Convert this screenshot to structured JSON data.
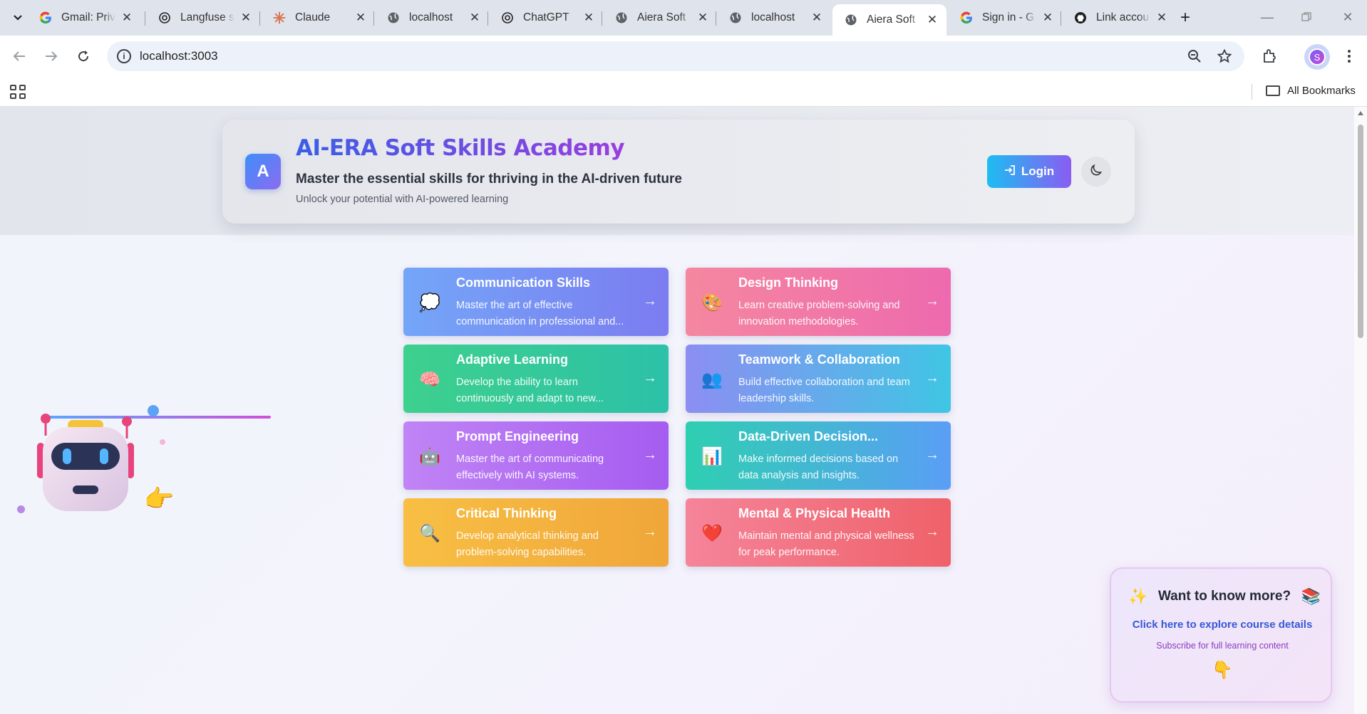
{
  "browser": {
    "tabs": [
      {
        "title": "Gmail: Priv",
        "favicon": "google-icon"
      },
      {
        "title": "Langfuse s",
        "favicon": "openai-icon"
      },
      {
        "title": "Claude",
        "favicon": "claude-icon"
      },
      {
        "title": "localhost",
        "favicon": "globe-icon"
      },
      {
        "title": "ChatGPT",
        "favicon": "openai-icon"
      },
      {
        "title": "Aiera Soft",
        "favicon": "globe-icon"
      },
      {
        "title": "localhost",
        "favicon": "globe-icon"
      },
      {
        "title": "Aiera Soft",
        "favicon": "globe-icon",
        "active": true
      },
      {
        "title": "Sign in - G",
        "favicon": "google-icon"
      },
      {
        "title": "Link accou",
        "favicon": "github-icon"
      }
    ],
    "url": "localhost:3003",
    "bookmarks_label": "All Bookmarks",
    "profile_initial": "S"
  },
  "header": {
    "logo_letter": "A",
    "title": "AI-ERA Soft Skills Academy",
    "subtitle": "Master the essential skills for thriving in the AI-driven future",
    "tagline": "Unlock your potential with AI-powered learning",
    "login_label": "Login"
  },
  "courses": [
    {
      "title": "Communication Skills",
      "desc": "Master the art of effective communication in professional and...",
      "icon": "💭",
      "gradient": [
        "#74a6f8",
        "#7b7cf0"
      ]
    },
    {
      "title": "Design Thinking",
      "desc": "Learn creative problem-solving and innovation methodologies.",
      "icon": "🎨",
      "gradient": [
        "#f587a0",
        "#ed6aae"
      ]
    },
    {
      "title": "Adaptive Learning",
      "desc": "Develop the ability to learn continuously and adapt to new...",
      "icon": "🧠",
      "gradient": [
        "#3ed08d",
        "#2cc1a8"
      ]
    },
    {
      "title": "Teamwork & Collaboration",
      "desc": "Build effective collaboration and team leadership skills.",
      "icon": "👥",
      "gradient": [
        "#8c8ef2",
        "#3fc6e4"
      ]
    },
    {
      "title": "Prompt Engineering",
      "desc": "Master the art of communicating effectively with AI systems.",
      "icon": "🤖",
      "gradient": [
        "#c084f5",
        "#a55cf0"
      ]
    },
    {
      "title": "Data-Driven Decision...",
      "desc": "Make informed decisions based on data analysis and insights.",
      "icon": "📊",
      "gradient": [
        "#2ecfb1",
        "#5a9ef6"
      ]
    },
    {
      "title": "Critical Thinking",
      "desc": "Develop analytical thinking and problem-solving capabilities.",
      "icon": "🔍",
      "gradient": [
        "#f8bf44",
        "#f0a63a"
      ]
    },
    {
      "title": "Mental & Physical Health",
      "desc": "Maintain mental and physical wellness for peak performance.",
      "icon": "❤️",
      "gradient": [
        "#f5849a",
        "#ef6169"
      ]
    }
  ],
  "promo": {
    "title": "Want to know more?",
    "link": "Click here to explore course details",
    "sub": "Subscribe for full learning content",
    "left_icon": "✨",
    "right_icon": "📚",
    "point_icon": "👇"
  }
}
